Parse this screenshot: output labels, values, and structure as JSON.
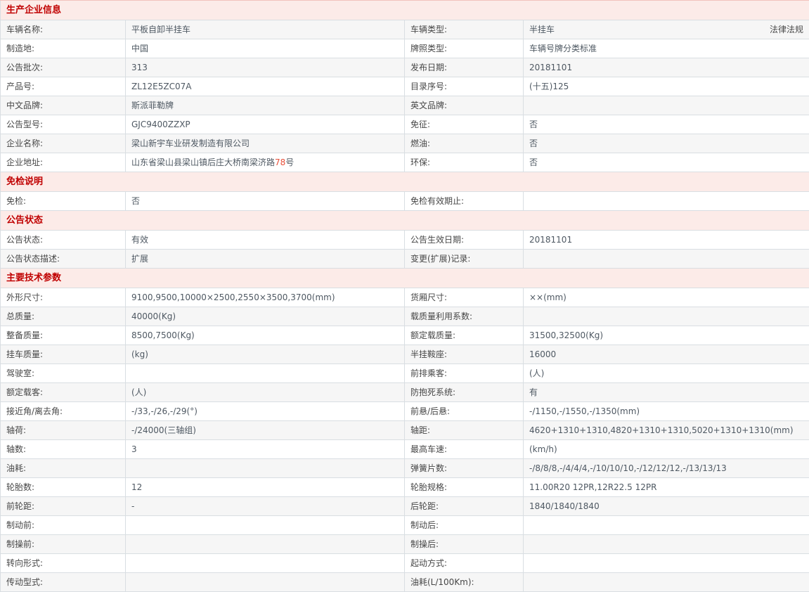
{
  "legal_link": "法律法规",
  "colors": {
    "section_header_bg": "#fcebe8",
    "section_header_text": "#c00000",
    "shaded_row_bg": "#f6f6f6",
    "highlight_text": "#e8503a",
    "border": "#d9dee2"
  },
  "sections": [
    {
      "title": "生产企业信息",
      "rows": [
        {
          "c": [
            "车辆名称:",
            "平板自卸半挂车",
            "车辆类型:",
            "半挂车"
          ],
          "trailing_link": true
        },
        {
          "c": [
            "制造地:",
            "中国",
            "牌照类型:",
            "车辆号牌分类标准"
          ]
        },
        {
          "c": [
            "公告批次:",
            "313",
            "发布日期:",
            "20181101"
          ]
        },
        {
          "c": [
            "产品号:",
            "ZL12E5ZC07A",
            "目录序号:",
            "(十五)125"
          ]
        },
        {
          "c": [
            "中文品牌:",
            "斯派菲勒牌",
            "英文品牌:",
            ""
          ]
        },
        {
          "c": [
            "公告型号:",
            "GJC9400ZZXP",
            "免征:",
            "否"
          ]
        },
        {
          "c": [
            "企业名称:",
            "梁山新宇车业研发制造有限公司",
            "燃油:",
            "否"
          ]
        },
        {
          "c": [
            "企业地址:",
            {
              "parts": [
                {
                  "t": "山东省梁山县梁山镇后庄大桥南梁济路"
                },
                {
                  "t": "78",
                  "hl": true
                },
                {
                  "t": "号"
                }
              ]
            },
            "环保:",
            "否"
          ]
        }
      ]
    },
    {
      "title": "免检说明",
      "rows": [
        {
          "c": [
            "免检:",
            "否",
            "免检有效期止:",
            ""
          ]
        }
      ]
    },
    {
      "title": "公告状态",
      "rows": [
        {
          "c": [
            "公告状态:",
            "有效",
            "公告生效日期:",
            "20181101"
          ]
        },
        {
          "c": [
            "公告状态描述:",
            "扩展",
            "变更(扩展)记录:",
            ""
          ]
        }
      ]
    },
    {
      "title": "主要技术参数",
      "rows": [
        {
          "c": [
            "外形尺寸:",
            "9100,9500,10000×2500,2550×3500,3700(mm)",
            "货厢尺寸:",
            "××(mm)"
          ]
        },
        {
          "c": [
            "总质量:",
            "40000(Kg)",
            "载质量利用系数:",
            ""
          ]
        },
        {
          "c": [
            "整备质量:",
            "8500,7500(Kg)",
            "额定载质量:",
            "31500,32500(Kg)"
          ]
        },
        {
          "c": [
            "挂车质量:",
            "(kg)",
            "半挂鞍座:",
            "16000"
          ]
        },
        {
          "c": [
            "驾驶室:",
            "",
            "前排乘客:",
            "(人)"
          ]
        },
        {
          "c": [
            "额定载客:",
            "(人)",
            "防抱死系统:",
            "有"
          ]
        },
        {
          "c": [
            "接近角/离去角:",
            "-/33,-/26,-/29(°)",
            "前悬/后悬:",
            "-/1150,-/1550,-/1350(mm)"
          ]
        },
        {
          "c": [
            "轴荷:",
            "-/24000(三轴组)",
            "轴距:",
            "4620+1310+1310,4820+1310+1310,5020+1310+1310(mm)"
          ]
        },
        {
          "c": [
            "轴数:",
            "3",
            "最高车速:",
            "(km/h)"
          ]
        },
        {
          "c": [
            "油耗:",
            "",
            "弹簧片数:",
            "-/8/8/8,-/4/4/4,-/10/10/10,-/12/12/12,-/13/13/13"
          ]
        },
        {
          "c": [
            "轮胎数:",
            "12",
            "轮胎规格:",
            "11.00R20 12PR,12R22.5 12PR"
          ]
        },
        {
          "c": [
            "前轮距:",
            "-",
            "后轮距:",
            "1840/1840/1840"
          ]
        },
        {
          "c": [
            "制动前:",
            "",
            "制动后:",
            ""
          ]
        },
        {
          "c": [
            "制操前:",
            "",
            "制操后:",
            ""
          ]
        },
        {
          "c": [
            "转向形式:",
            "",
            "起动方式:",
            ""
          ]
        },
        {
          "c": [
            "传动型式:",
            "",
            "油耗(L/100Km):",
            ""
          ]
        }
      ]
    }
  ]
}
